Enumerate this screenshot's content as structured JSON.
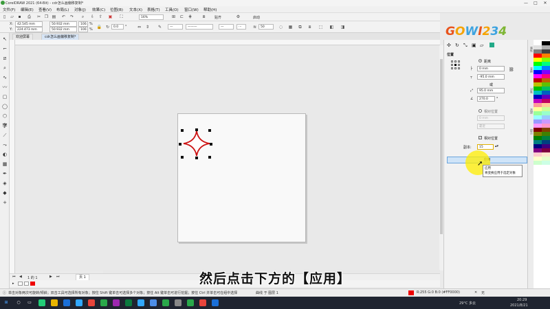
{
  "app": {
    "title": "CorelDRAW 2021 (64-Bit) - cdr怎么画偏移复制*",
    "window_controls": [
      "—",
      "□",
      "✕"
    ]
  },
  "menu": [
    "文件(F)",
    "编辑(E)",
    "查看(V)",
    "布局(L)",
    "对象(J)",
    "效果(C)",
    "位图(B)",
    "文本(X)",
    "表格(T)",
    "工具(O)",
    "窗口(W)",
    "帮助(H)"
  ],
  "toolbar1": {
    "zoom": "16%",
    "snap_label": "贴齐",
    "launch_label": "启动"
  },
  "toolbar2": {
    "x": "42.545 mm",
    "y": "224.473 mm",
    "w": "50.932 mm",
    "h": "50.932 mm",
    "sx": "100.0",
    "sy": "100.0",
    "unit": "%",
    "angle": "0.0",
    "outline_width": "50",
    "degree_sign": "°"
  },
  "tabs": [
    "欢迎屏幕",
    "cdr怎么画偏移复制*"
  ],
  "page_nav": {
    "label": "1 的 1",
    "page_tab": "页 1"
  },
  "docker": {
    "title": "位置",
    "distance_label": "距离",
    "h_value": "0 mm",
    "v_value": "-95.0 mm",
    "or_label": "或",
    "polar_distance": "95.0 mm",
    "polar_angle": "270.0",
    "polar_angle_unit": "°",
    "relative_label": "相对位置",
    "offset_value": "0 mm",
    "disabled_value": "靠近",
    "relative_pos_label": "相对位置",
    "copies_label": "副本:",
    "copies_value": "15",
    "apply_label": "应用",
    "tooltip_title": "应用",
    "tooltip_text": "将变换应用于选定对象"
  },
  "right_tabs": [
    "属性",
    "变换",
    "对象",
    "选择",
    "提示"
  ],
  "logo": {
    "text": "GOWI234",
    "colors": [
      "#e8541d",
      "#f5a300",
      "#3ca3e0",
      "#e8541d",
      "#f5a300",
      "#3ca3e0",
      "#7db533"
    ]
  },
  "status": {
    "hint": "单击对象两次可旋转/倾斜；双击工具可选择所有对象；按住 Shift 键单击可选择多个对象；按住 Alt 键单击可进行挖掘；按住 Ctrl 并单击可在组中选择",
    "object": "曲线 于 图层 1",
    "fill": "R:255 G:0 B:0 (#FF0000)",
    "outline": "无"
  },
  "subtitle": "然后点击下方的【应用】",
  "taskbar": {
    "time": "20:29",
    "date": "2021/8/21",
    "weather": "29°C 多云"
  },
  "colors": {
    "star_fill": "#ffffff",
    "star_outline": "#cc1111",
    "accent": "#6aa4dc"
  }
}
